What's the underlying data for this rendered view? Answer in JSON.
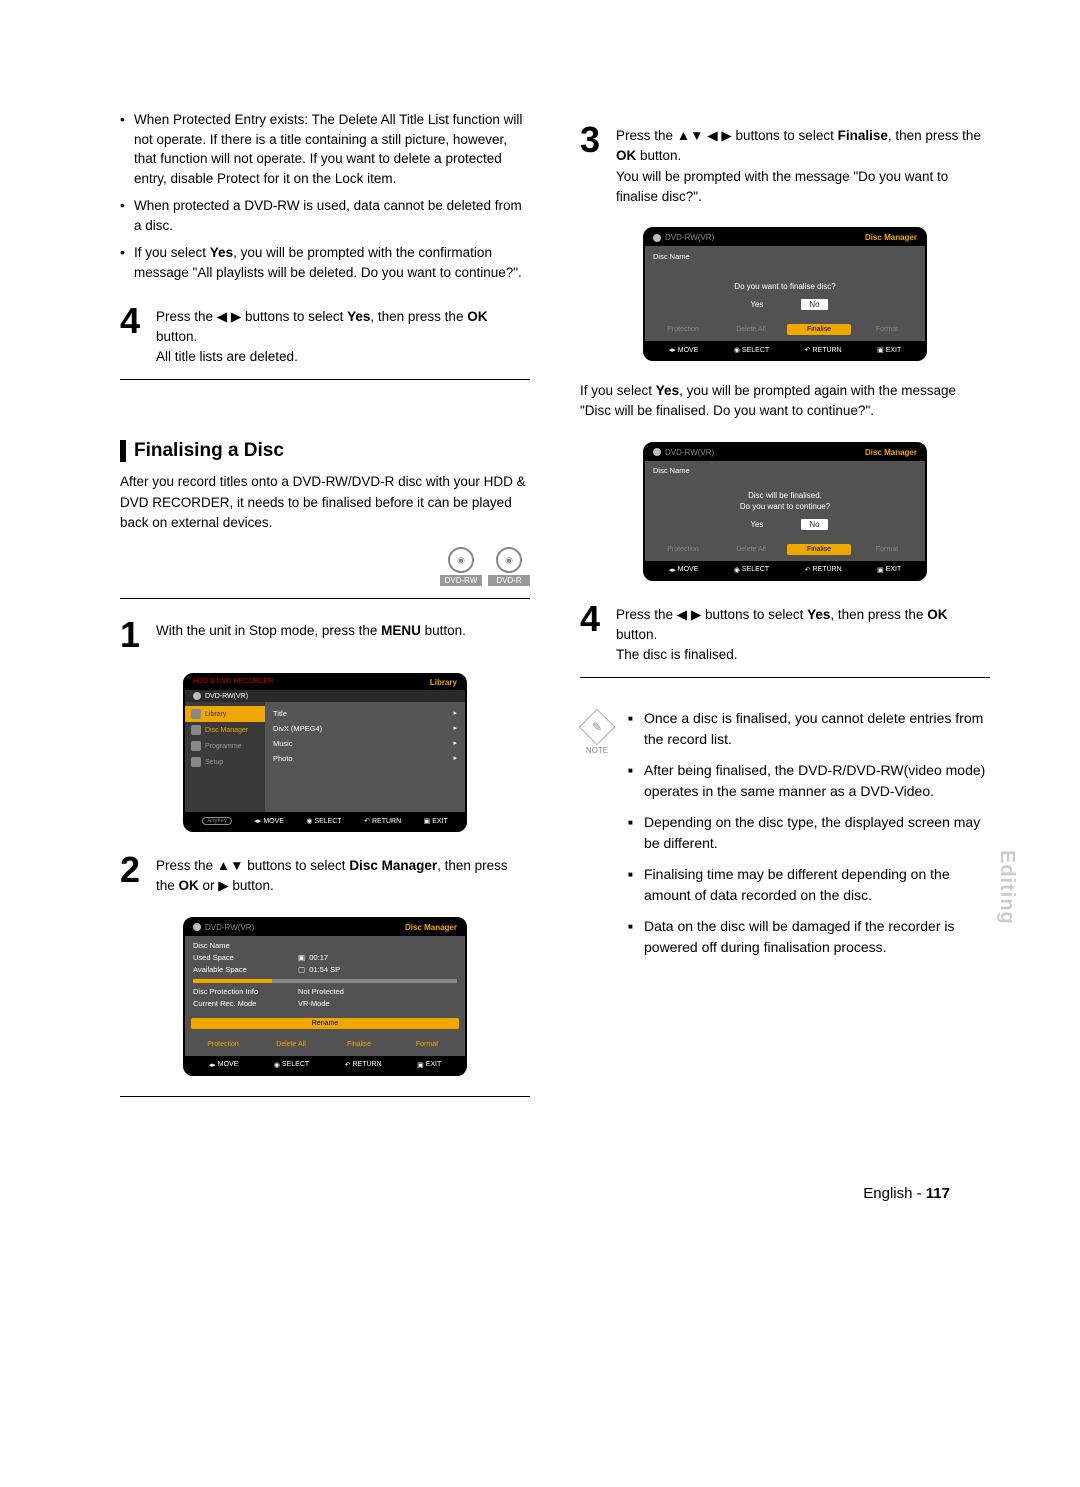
{
  "left": {
    "bullets": [
      "When Protected Entry exists: The Delete All Title List function will not operate. If there is a title containing a still picture, however, that function will not operate. If you want to delete a protected entry, disable Protect for it on the Lock item.",
      "When protected a DVD-RW is used, data cannot be deleted from a disc.",
      "If you select <b>Yes</b>, you will be prompted with the confirmation message \"All playlists will be deleted. Do you want to continue?\"."
    ],
    "step4": {
      "num": "4",
      "text": "Press the ◀ ▶ buttons to select <b>Yes</b>, then press the <b>OK</b> button.<br>All title lists are deleted."
    },
    "section_title": "Finalising a Disc",
    "section_intro": "After you record titles onto a DVD-RW/DVD-R disc with your HDD & DVD RECORDER, it needs to be finalised before it can be played back on external devices.",
    "badges": [
      "DVD-RW",
      "DVD-R"
    ],
    "step1": {
      "num": "1",
      "text": "With the unit in Stop mode, press the <b>MENU</b> button."
    },
    "step2": {
      "num": "2",
      "text": "Press the ▲▼ buttons to select <b>Disc Manager</b>, then press the <b>OK</b> or ▶ button."
    }
  },
  "right": {
    "step3": {
      "num": "3",
      "text": "Press the ▲▼ ◀ ▶ buttons to select <b>Finalise</b>, then press the <b>OK</b> button.<br>You will be prompted with the message \"Do you want to finalise disc?\"."
    },
    "mid_para": "If you select <b>Yes</b>, you will be prompted again with the message \"Disc will be finalised. Do you want to continue?\".",
    "step4": {
      "num": "4",
      "text": "Press the ◀ ▶ buttons to select <b>Yes</b>, then press the <b>OK</b> button.<br>The disc is finalised."
    },
    "note_label": "NOTE",
    "notes": [
      "Once a disc is finalised, you cannot delete entries from the record list.",
      "After being finalised, the DVD-R/DVD-RW(video mode) operates in the same manner as a DVD-Video.",
      "Depending on the disc type, the displayed screen may be different.",
      "Finalising time may be different depending on the amount of data recorded on the disc.",
      "Data on the disc will be damaged if the recorder is powered off during finalisation process."
    ]
  },
  "osd1": {
    "top_label": "HDD & DVD RECORDER",
    "corner": "Library",
    "crumb": "DVD-RW(VR)",
    "side": [
      "Library",
      "Disc Manager",
      "Programme",
      "Setup"
    ],
    "list": [
      "Title",
      "DivX (MPEG4)",
      "Music",
      "Photo"
    ]
  },
  "osd2": {
    "header_left": "DVD-RW(VR)",
    "header_right": "Disc Manager",
    "rows": {
      "disc_name": "Disc Name",
      "used_label": "Used Space",
      "used": "00:17",
      "avail_label": "Available Space",
      "avail": "01:54 SP",
      "prot_label": "Disc Protection Info",
      "prot": "Not Protected",
      "mode_label": "Current Rec. Mode",
      "mode": "VR-Mode"
    },
    "btns": [
      "Rename",
      "Protection",
      "Delete All",
      "Finalise",
      "Format"
    ]
  },
  "osd3": {
    "header_left": "DVD-RW(VR)",
    "header_right": "Disc Manager",
    "disc_name": "Disc Name",
    "prompt": "Do you want to finalise disc?",
    "yes": "Yes",
    "no": "No",
    "btns": [
      "Protection",
      "Delete All",
      "Finalise",
      "Format"
    ]
  },
  "osd4": {
    "header_left": "DVD-RW(VR)",
    "header_right": "Disc Manager",
    "disc_name": "Disc Name",
    "prompt1": "Disc will be finalised.",
    "prompt2": "Do you want to continue?",
    "yes": "Yes",
    "no": "No",
    "btns": [
      "Protection",
      "Delete All",
      "Finalise",
      "Format"
    ]
  },
  "footer_keys": {
    "anykey": "Anykey",
    "move": "MOVE",
    "select": "SELECT",
    "return": "RETURN",
    "exit": "EXIT"
  },
  "side_tab": "Editing",
  "page_footer": {
    "lang": "English",
    "sep": " - ",
    "num": "117"
  }
}
